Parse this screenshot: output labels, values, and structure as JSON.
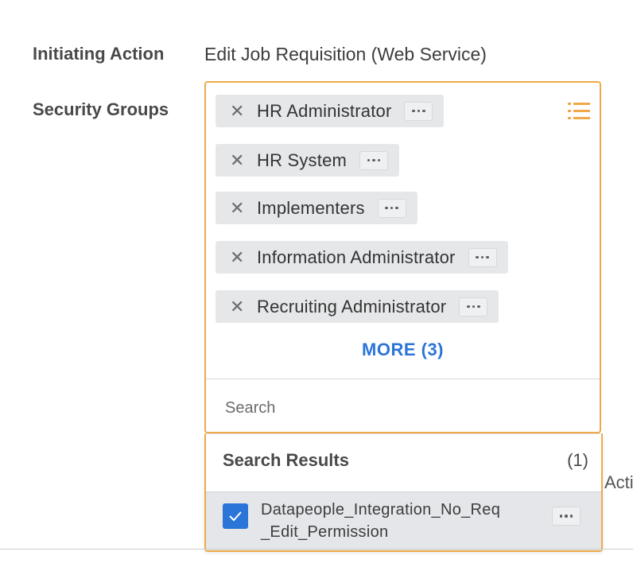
{
  "initiating_action": {
    "label": "Initiating Action",
    "value": "Edit Job Requisition (Web Service)"
  },
  "security_groups": {
    "label": "Security Groups",
    "selected": [
      "HR Administrator",
      "HR System",
      "Implementers",
      "Information Administrator",
      "Recruiting Administrator"
    ],
    "more_label": "MORE (3)",
    "search_placeholder": "Search"
  },
  "search_results": {
    "heading": "Search Results",
    "count": "(1)",
    "items": [
      {
        "line1": "Datapeople_Integration_No_Req",
        "line2": "_Edit_Permission",
        "checked": true
      }
    ]
  },
  "background_text": "Activ",
  "icons": {
    "remove": "close-icon",
    "related_actions": "more-dots-icon",
    "list": "list-icon",
    "check": "checkmark-icon"
  },
  "colors": {
    "focus_border": "#f0a94a",
    "link": "#2b74d8",
    "checkbox": "#2b74d8",
    "pill_bg": "#e6e7e9"
  }
}
